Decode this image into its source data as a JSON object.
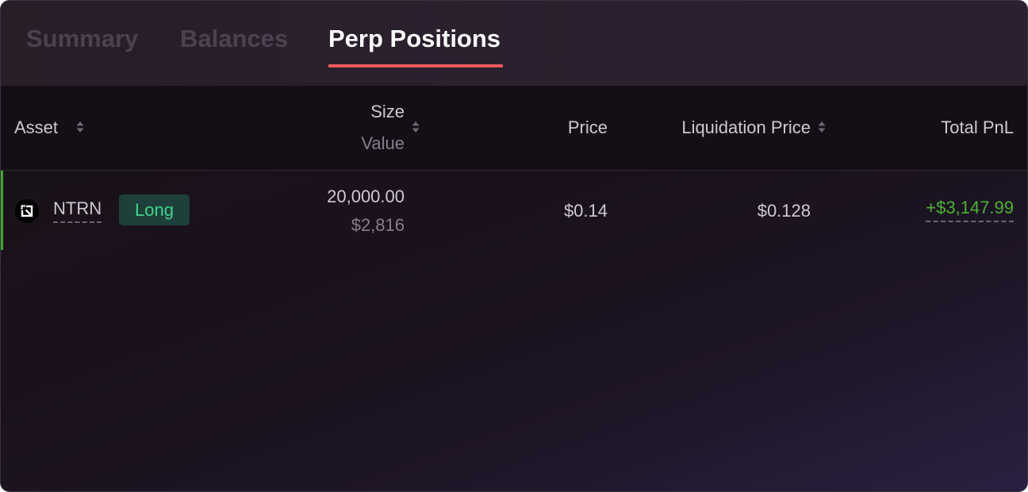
{
  "tabs": [
    {
      "label": "Summary",
      "active": false
    },
    {
      "label": "Balances",
      "active": false
    },
    {
      "label": "Perp Positions",
      "active": true
    }
  ],
  "table": {
    "headers": {
      "asset": "Asset",
      "size": "Size",
      "value": "Value",
      "price": "Price",
      "liquidation_price": "Liquidation Price",
      "total_pnl": "Total PnL"
    },
    "rows": [
      {
        "asset": "NTRN",
        "asset_icon": "neutron-icon",
        "side": "Long",
        "size": "20,000.00",
        "value": "$2,816",
        "price": "$0.14",
        "liquidation_price": "$0.128",
        "total_pnl": "+$3,147.99"
      }
    ]
  },
  "colors": {
    "active_tab_underline": "#ee5a5f",
    "long_badge_text": "#3ed58a",
    "long_badge_bg": "#1f3f3a",
    "pnl_positive": "#48b333",
    "row_accent": "#3fa82f"
  }
}
